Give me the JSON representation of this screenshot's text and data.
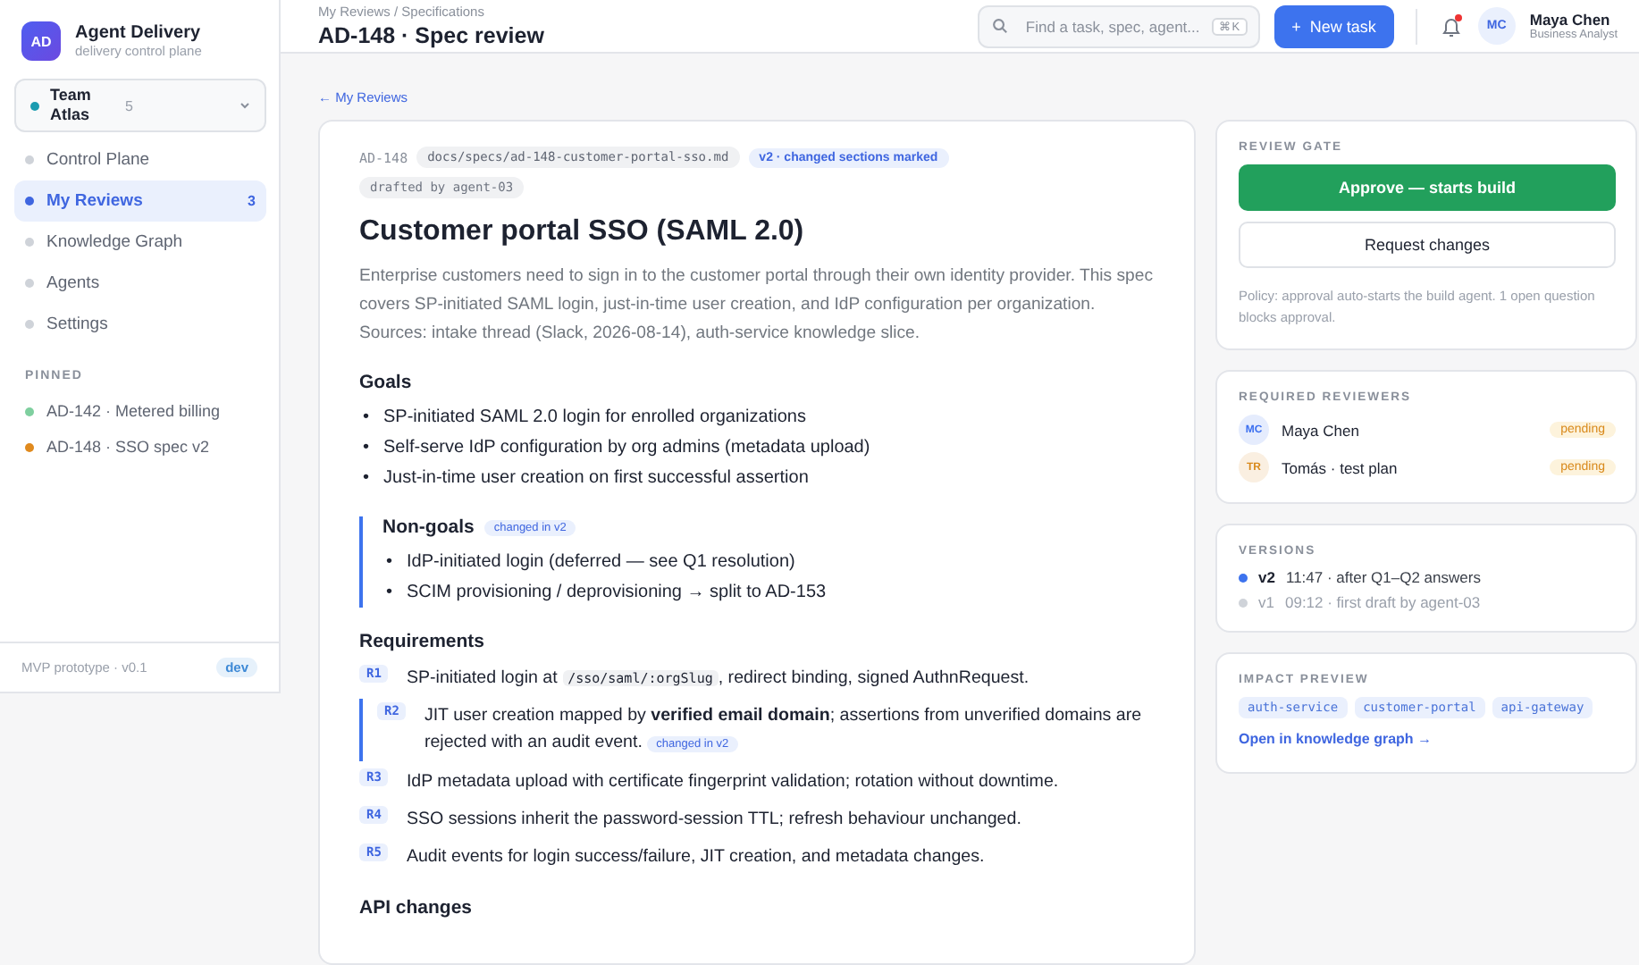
{
  "sidebar": {
    "app": {
      "logo": "AD",
      "name": "Agent Delivery",
      "tagline": "delivery control plane"
    },
    "team": {
      "name": "Team Atlas",
      "count": "5",
      "color": "#1a9bb0"
    },
    "nav": [
      {
        "label": "Control Plane",
        "selected": false
      },
      {
        "label": "My Reviews",
        "selected": true,
        "count": "3"
      },
      {
        "label": "Knowledge Graph",
        "selected": false
      },
      {
        "label": "Agents",
        "selected": false
      },
      {
        "label": "Settings",
        "selected": false
      }
    ],
    "pinned_title": "PINNED",
    "pinned": [
      {
        "label": "AD-142 · Metered billing",
        "color": "#7fcf9f"
      },
      {
        "label": "AD-148 · SSO spec v2",
        "color": "#e08a1e"
      }
    ],
    "footer": {
      "text": "MVP prototype · v0.1",
      "badge": "dev"
    }
  },
  "header": {
    "breadcrumb": "My Reviews / Specifications",
    "title": "AD-148 · Spec review",
    "search": {
      "placeholder": "Find a task, spec, agent...",
      "shortcut": "⌘K"
    },
    "new_button": {
      "icon": "+",
      "label": "New task"
    },
    "notifications": {
      "unread": true
    },
    "user": {
      "initials": "MC",
      "name": "Maya Chen",
      "role": "Business Analyst"
    }
  },
  "back_link": "← My Reviews",
  "doc": {
    "id": "AD-148",
    "path": "docs/specs/ad-148-customer-portal-sso.md",
    "version_tag": "v2 · changed sections marked",
    "author_tag": "drafted by agent-03",
    "title": "Customer portal SSO (SAML 2.0)",
    "intro": "Enterprise customers need to sign in to the customer portal through their own identity provider. This spec covers SP-initiated SAML login, just-in-time user creation, and IdP configuration per organization. Sources: intake thread (Slack, 2026-08-14), auth-service knowledge slice.",
    "sections": [
      {
        "kind": "list",
        "title": "Goals",
        "changed": false,
        "marker": "•",
        "items": [
          "SP-initiated SAML 2.0 login for enrolled organizations",
          "Self-serve IdP configuration by org admins (metadata upload)",
          "Just-in-time user creation on first successful assertion"
        ]
      },
      {
        "kind": "list",
        "title": "Non-goals",
        "changed": true,
        "badge": "changed in v2",
        "marker": "•",
        "items": [
          "IdP-initiated login (deferred — see Q1 resolution)",
          "SCIM provisioning / deprovisioning → split to AD-153"
        ]
      },
      {
        "kind": "requirements",
        "title": "Requirements",
        "changed": false,
        "items": [
          {
            "id": "R1",
            "changed": false,
            "parts": [
              {
                "kind": "text",
                "text": "SP-initiated login at "
              },
              {
                "kind": "code",
                "text": "/sso/saml/:orgSlug"
              },
              {
                "kind": "text",
                "text": ", redirect binding, signed AuthnRequest."
              }
            ]
          },
          {
            "id": "R2",
            "changed": true,
            "badge": "changed in v2",
            "parts": [
              {
                "kind": "text",
                "text": "JIT user creation mapped by **verified email domain**; assertions from unverified domains are rejected with an audit event."
              }
            ]
          },
          {
            "id": "R3",
            "changed": false,
            "parts": [
              {
                "kind": "text",
                "text": "IdP metadata upload with certificate fingerprint validation; rotation without downtime."
              }
            ]
          },
          {
            "id": "R4",
            "changed": false,
            "parts": [
              {
                "kind": "text",
                "text": "SSO sessions inherit the password-session TTL; refresh behaviour unchanged."
              }
            ]
          },
          {
            "id": "R5",
            "changed": false,
            "parts": [
              {
                "kind": "text",
                "text": "Audit events for login success/failure, JIT creation, and metadata changes."
              }
            ]
          }
        ]
      },
      {
        "kind": "heading",
        "title": "API changes",
        "changed": false
      }
    ]
  },
  "review_gate": {
    "title": "REVIEW GATE",
    "approve": "Approve — starts build",
    "request": "Request changes",
    "policy": "Policy: approval auto-starts the build agent. 1 open question blocks approval."
  },
  "reviewers": {
    "title": "REQUIRED REVIEWERS",
    "items": [
      {
        "initials": "MC",
        "name": "Maya Chen",
        "status": "pending",
        "color": "#3b6ff0"
      },
      {
        "initials": "TR",
        "name": "Tomás · test plan",
        "status": "pending",
        "color": "#d98a1c"
      }
    ]
  },
  "versions": {
    "title": "VERSIONS",
    "items": [
      {
        "label": "v2",
        "detail": "11:47 · after Q1–Q2 answers",
        "selected": true
      },
      {
        "label": "v1",
        "detail": "09:12 · first draft by agent-03",
        "selected": false
      }
    ]
  },
  "impact": {
    "title": "IMPACT PREVIEW",
    "services": [
      "auth-service",
      "customer-portal",
      "api-gateway"
    ],
    "link": "Open in knowledge graph →"
  }
}
